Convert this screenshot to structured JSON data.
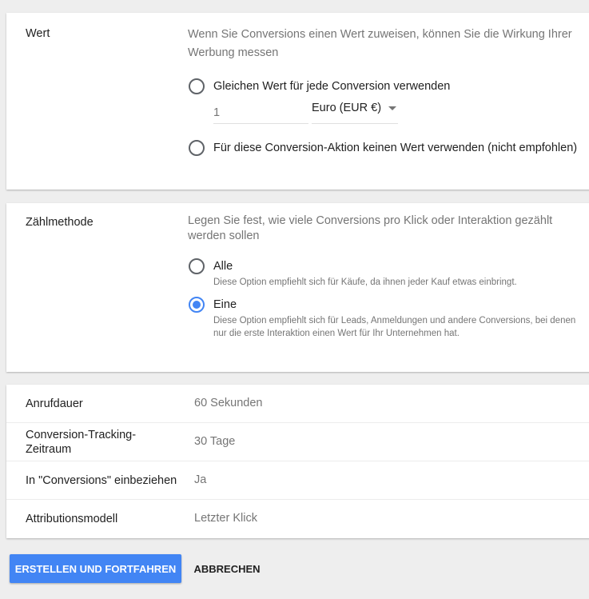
{
  "value_section": {
    "label": "Wert",
    "description": "Wenn Sie Conversions einen Wert zuweisen, können Sie die Wirkung Ihrer Werbung messen",
    "options": [
      {
        "label": "Gleichen Wert für jede Conversion verwenden",
        "selected": false
      },
      {
        "label": "Für diese Conversion-Aktion keinen Wert verwenden (nicht empfohlen)",
        "selected": false
      }
    ],
    "value_input_placeholder": "1",
    "currency": "Euro (EUR €)"
  },
  "count_section": {
    "label": "Zählmethode",
    "description": "Legen Sie fest, wie viele Conversions pro Klick oder Interaktion gezählt werden sollen",
    "options": [
      {
        "label": "Alle",
        "hint": "Diese Option empfiehlt sich für Käufe, da ihnen jeder Kauf etwas einbringt.",
        "selected": false
      },
      {
        "label": "Eine",
        "hint": "Diese Option empfiehlt sich für Leads, Anmeldungen und andere Conversions, bei denen nur die erste Interaktion einen Wert für Ihr Unternehmen hat.",
        "selected": true
      }
    ]
  },
  "settings": [
    {
      "name": "Anrufdauer",
      "value": "60 Sekunden"
    },
    {
      "name": "Conversion-Tracking-Zeitraum",
      "value": "30 Tage"
    },
    {
      "name": "In \"Conversions\" einbeziehen",
      "value": "Ja"
    },
    {
      "name": "Attributionsmodell",
      "value": "Letzter Klick"
    }
  ],
  "actions": {
    "primary_label": "ERSTELLEN UND FORTFAHREN",
    "cancel_label": "ABBRECHEN"
  },
  "colors": {
    "accent": "#4285f4",
    "background": "#eeeeee",
    "secondary_text": "#757575"
  }
}
